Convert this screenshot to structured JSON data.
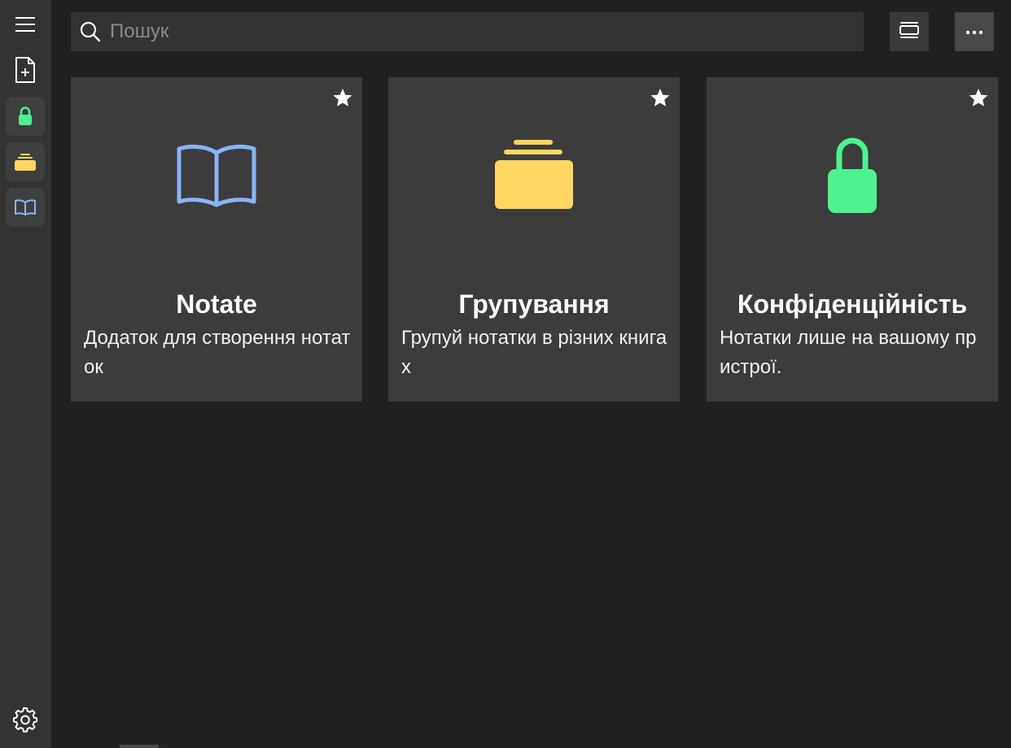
{
  "colors": {
    "background": "#212121",
    "sidebar": "#333333",
    "card": "#3c3c3c",
    "book_blue": "#8ab4f8",
    "folder_yellow": "#ffd662",
    "lock_green": "#4ef28e"
  },
  "sidebar": {
    "items": [
      {
        "icon": "hamburger-menu-icon"
      },
      {
        "icon": "new-note-icon"
      },
      {
        "icon": "lock-icon"
      },
      {
        "icon": "folder-icon"
      },
      {
        "icon": "book-icon"
      }
    ],
    "settings_icon": "gear-icon"
  },
  "search": {
    "placeholder": "Пошук",
    "value": ""
  },
  "toolbar": {
    "view_icon": "view-layout-icon",
    "more_icon": "more-options-icon"
  },
  "cards": [
    {
      "icon": "book-icon",
      "title": "Notate",
      "description": "Додаток для створення нотаток"
    },
    {
      "icon": "folder-icon",
      "title": "Групування",
      "description": "Групуй нотатки в різних книгах"
    },
    {
      "icon": "lock-icon",
      "title": "Конфіденційність",
      "description": "Нотатки лише на вашому пристрої."
    }
  ]
}
